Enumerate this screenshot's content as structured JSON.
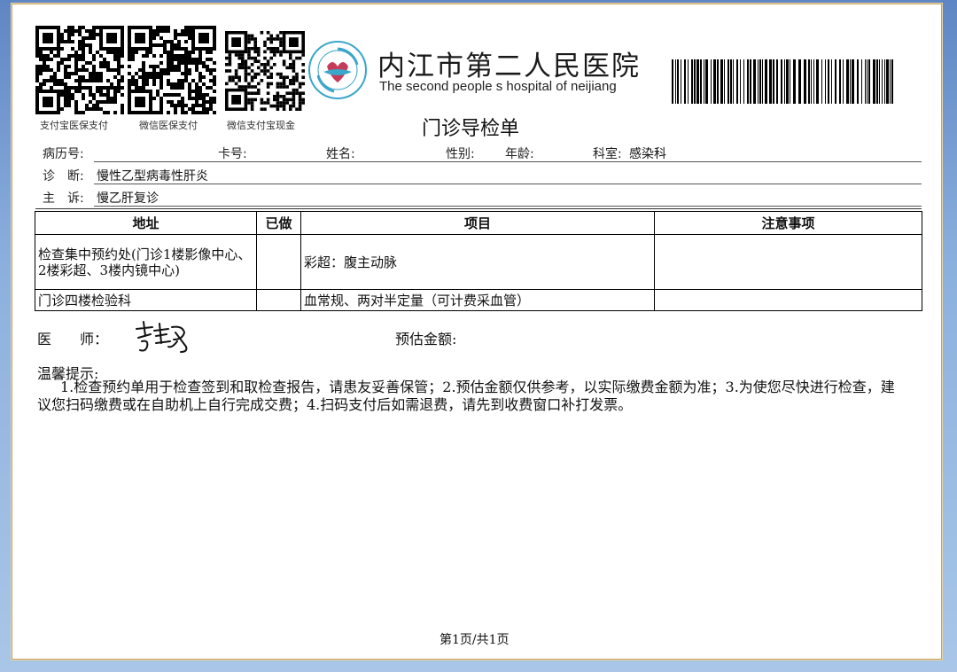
{
  "payment_codes": [
    {
      "label": "支付宝医保支付",
      "icon": "qr-code-icon"
    },
    {
      "label": "微信医保支付",
      "icon": "qr-code-icon"
    },
    {
      "label": "微信支付宝现金",
      "icon": "qr-code-icon"
    }
  ],
  "hospital": {
    "name_cn": "内江市第二人民医院",
    "name_en": "The second people s hospital of neijiang",
    "logo_icon": "hospital-logo-icon",
    "barcode_icon": "barcode-icon"
  },
  "title": "门诊导检单",
  "patient": {
    "record_no_label": "病历号:",
    "record_no": "",
    "card_no_label": "卡号:",
    "card_no": "",
    "name_label": "姓名:",
    "name": "",
    "sex_label": "性别:",
    "sex": "",
    "age_label": "年龄:",
    "age": "",
    "dept_label": "科室:",
    "dept": "感染科",
    "diagnosis_label": "诊　断:",
    "diagnosis": "慢性乙型病毒性肝炎",
    "complaint_label": "主　诉:",
    "complaint": "慢乙肝复诊"
  },
  "table": {
    "headers": [
      "地址",
      "已做",
      "项目",
      "注意事项"
    ],
    "rows": [
      {
        "address": "检查集中预约处(门诊1楼影像中心、2楼彩超、3楼内镜中心)",
        "done": "",
        "item": "彩超：腹主动脉",
        "notes": ""
      },
      {
        "address": "门诊四楼检验科",
        "done": "",
        "item": "血常规、两对半定量（可计费采血管）",
        "notes": ""
      }
    ]
  },
  "doctor_label": "医　　师：",
  "estimate_label": "预估金额:",
  "estimate": "",
  "tips_title": "温馨提示:",
  "tips_body": "1.检查预约单用于检查签到和取检查报告，请患友妥善保管；2.预估金额仅供参考，以实际缴费金额为准；3.为使您尽快进行检查，建议您扫码缴费或在自助机上自行完成交费；4.扫码支付后如需退费，请先到收费窗口补打发票。",
  "pager": "第1页/共1页",
  "colors": {
    "background": "#7fa3d6",
    "border": "#c9a25b",
    "logo_blue": "#3aa6c9",
    "logo_pink": "#c63b5a"
  }
}
